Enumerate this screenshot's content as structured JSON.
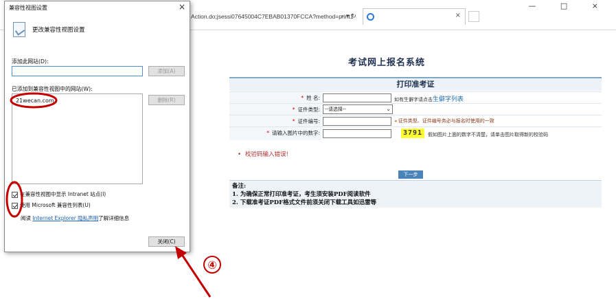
{
  "browser": {
    "address_text": "Action.do;jsessi07645004C7EBAB01370FCCA?method=print1",
    "address_tools": "⌕ ▾ ↻",
    "tab_close": "×",
    "window_controls": "— □ ×"
  },
  "page": {
    "system_title": "考试网上报名系统",
    "form_title": "打印准考证",
    "rows": [
      {
        "label": "姓    名:",
        "hint_plain": "如有生僻字请点击",
        "hint_link": "生僻字列表"
      },
      {
        "label": "证件类型:",
        "select_value": "--请选择--"
      },
      {
        "label": "证件编号:",
        "hint_warn": "证件类型、证件编号务必与报名时使用的一致"
      },
      {
        "label": "请输入图片中的数字:",
        "captcha": "3791",
        "captcha_hint": "假如图片上面的数字不清楚，请单击图片取得新的校验码"
      }
    ],
    "error_message": "校验码输入错误!",
    "next_button": "下一步",
    "notes": {
      "title": "备注:",
      "items": [
        "1.  为确保正常打印准考证，考生须安装PDF阅读软件",
        "2.  下载准考证PDF格式文件前须关闭下载工具如迅雷等"
      ]
    }
  },
  "dialog": {
    "title": "兼容性视图设置",
    "close": "×",
    "heading": "更改兼容性视图设置",
    "add_label": "添加此网站(D):",
    "add_input_value": "",
    "add_button": "添加(A)",
    "list_label": "已添加到兼容性视图中的网站(W):",
    "sites": [
      "21wecan.com"
    ],
    "remove_button": "删除(R)",
    "checkbox_intranet": "在兼容性视图中显示 Intranet 站点(I)",
    "checkbox_intranet_checked": true,
    "checkbox_mslist": "使用 Microsoft 兼容性列表(U)",
    "checkbox_mslist_checked": true,
    "privacy_prefix": "阅读",
    "privacy_link": "Internet Explorer 隐私声明",
    "privacy_suffix": "了解详细信息",
    "close_button": "关闭(C)"
  },
  "annotation": {
    "step_number": "④",
    "color": "#c40000"
  }
}
